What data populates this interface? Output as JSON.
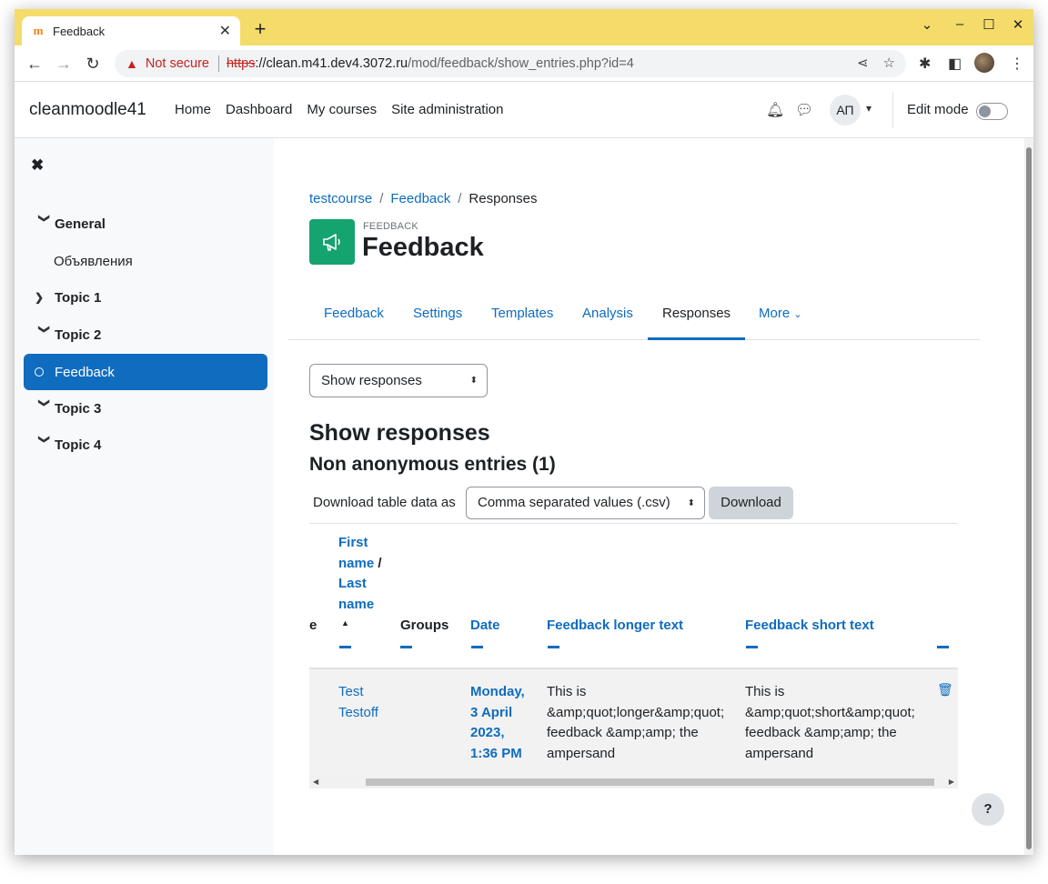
{
  "browser": {
    "tab_title": "Feedback",
    "tab_close": "✕",
    "new_tab": "+",
    "favicon": "m",
    "not_secure": "Not secure",
    "url_scheme": "https",
    "url_host": "://clean.m41.dev4.3072.ru",
    "url_path": "/mod/feedback/show_entries.php?id=4"
  },
  "navbar": {
    "brand": "cleanmoodle41",
    "items": [
      "Home",
      "Dashboard",
      "My courses",
      "Site administration"
    ],
    "avatar_initials": "АП",
    "edit_mode_label": "Edit mode"
  },
  "drawer": {
    "items": [
      {
        "label": "General",
        "type": "section-open"
      },
      {
        "label": "Объявления",
        "type": "sub"
      },
      {
        "label": "Topic 1",
        "type": "section-closed"
      },
      {
        "label": "Topic 2",
        "type": "section-open"
      },
      {
        "label": "Feedback",
        "type": "active"
      },
      {
        "label": "Topic 3",
        "type": "section-open"
      },
      {
        "label": "Topic 4",
        "type": "section-open"
      }
    ]
  },
  "breadcrumb": {
    "course": "testcourse",
    "activity": "Feedback",
    "current": "Responses",
    "sep": "/"
  },
  "header": {
    "module_type": "FEEDBACK",
    "title": "Feedback"
  },
  "secondary_nav": {
    "tabs": [
      "Feedback",
      "Settings",
      "Templates",
      "Analysis",
      "Responses",
      "More"
    ],
    "active": "Responses"
  },
  "view_select": {
    "value": "Show responses"
  },
  "headings": {
    "show_responses": "Show responses",
    "non_anonymous": "Non anonymous entries (1)"
  },
  "download": {
    "label": "Download table data as",
    "format": "Comma separated values (.csv)",
    "button": "Download"
  },
  "table": {
    "col_partial": "e",
    "col_name_first": "First name",
    "col_name_sep": "/",
    "col_name_last": "Last name",
    "col_groups": "Groups",
    "col_date": "Date",
    "col_longer": "Feedback longer text",
    "col_short": "Feedback short text",
    "rows": [
      {
        "name": "Test Testoff",
        "groups": "",
        "date": "Monday, 3 April 2023, 1:36 PM",
        "longer": "This is &amp;quot;longer&amp;quot; feedback &amp;amp; the ampersand",
        "short": "This is &amp;quot;short&amp;quot; feedback &amp;amp; the ampersand"
      }
    ]
  },
  "help_label": "?"
}
